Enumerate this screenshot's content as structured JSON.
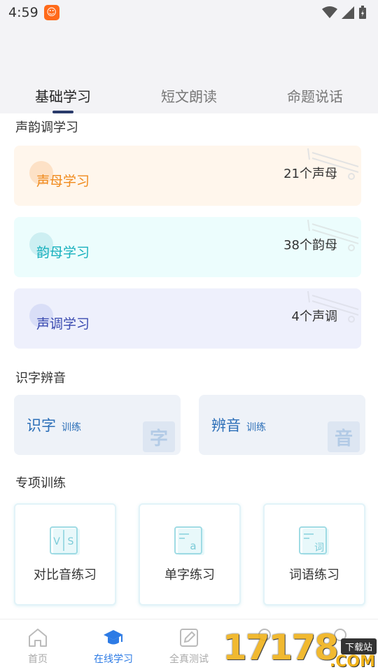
{
  "status": {
    "time": "4:59"
  },
  "tabs": [
    {
      "label": "基础学习",
      "active": true
    },
    {
      "label": "短文朗读",
      "active": false
    },
    {
      "label": "命题说话",
      "active": false
    }
  ],
  "sections": {
    "tones": "声韵调学习",
    "recognition": "识字辨音",
    "special": "专项训练"
  },
  "tone_cards": [
    {
      "big": "声",
      "rest": "母学习",
      "count": "21个声母",
      "bg": "#fff6ec",
      "accent": "#f08a1c",
      "circle": "#fde1c6"
    },
    {
      "big": "韵",
      "rest": "母学习",
      "count": "38个韵母",
      "bg": "#ecfdfd",
      "accent": "#17b0bd",
      "circle": "#cdeff2"
    },
    {
      "big": "声",
      "rest": "调学习",
      "count": "4个声调",
      "bg": "#eef0fc",
      "accent": "#3a4ab0",
      "circle": "#d9def7"
    }
  ],
  "recognition_cards": [
    {
      "main": "识字",
      "sub": "训练",
      "badge": "字"
    },
    {
      "main": "辨音",
      "sub": "训练",
      "badge": "音"
    }
  ],
  "training_cards": [
    {
      "label": "对比音练习",
      "icon": "vs-icon",
      "glyph": "V|S"
    },
    {
      "label": "单字练习",
      "icon": "single-char-icon",
      "glyph": "a"
    },
    {
      "label": "词语练习",
      "icon": "word-icon",
      "glyph": "词"
    }
  ],
  "nav": [
    {
      "label": "首页",
      "icon": "home-icon",
      "active": false
    },
    {
      "label": "在线学习",
      "icon": "graduation-cap-icon",
      "active": true
    },
    {
      "label": "全真测试",
      "icon": "pencil-icon",
      "active": false
    },
    {
      "label": "",
      "icon": "nav-icon-4",
      "active": false
    },
    {
      "label": "",
      "icon": "nav-icon-5",
      "active": false
    }
  ],
  "watermark": {
    "number": "17178",
    "domain": ".COM",
    "tag": "下载站"
  },
  "colors": {
    "nav_active": "#2d7be5",
    "tab_indicator": "#2a3b6b"
  }
}
